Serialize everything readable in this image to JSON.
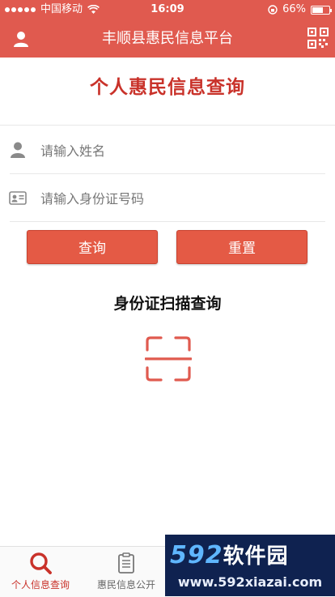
{
  "status_bar": {
    "carrier": "中国移动",
    "time": "16:09",
    "battery": "66%",
    "battery_level": 0.66
  },
  "header": {
    "title": "丰顺县惠民信息平台",
    "left_icon": "user-icon",
    "right_icon": "qr-code-icon"
  },
  "page": {
    "title": "个人惠民信息查询"
  },
  "form": {
    "name": {
      "placeholder": "请输入姓名",
      "value": "",
      "icon": "person-icon"
    },
    "id_number": {
      "placeholder": "请输入身份证号码",
      "value": "",
      "icon": "id-card-icon"
    },
    "query_label": "查询",
    "reset_label": "重置"
  },
  "scan": {
    "title": "身份证扫描查询",
    "icon": "scan-frame-icon"
  },
  "tabs": [
    {
      "label": "个人信息查询",
      "icon": "search-icon",
      "active": true
    },
    {
      "label": "惠民信息公开",
      "icon": "clipboard-icon",
      "active": false
    }
  ],
  "watermark": {
    "logo_number": "592",
    "logo_text": "软件园",
    "url": "www.592xiazai.com"
  },
  "colors": {
    "brand_red": "#e05a4f",
    "title_red": "#c9322a",
    "button_red": "#e45a45"
  }
}
